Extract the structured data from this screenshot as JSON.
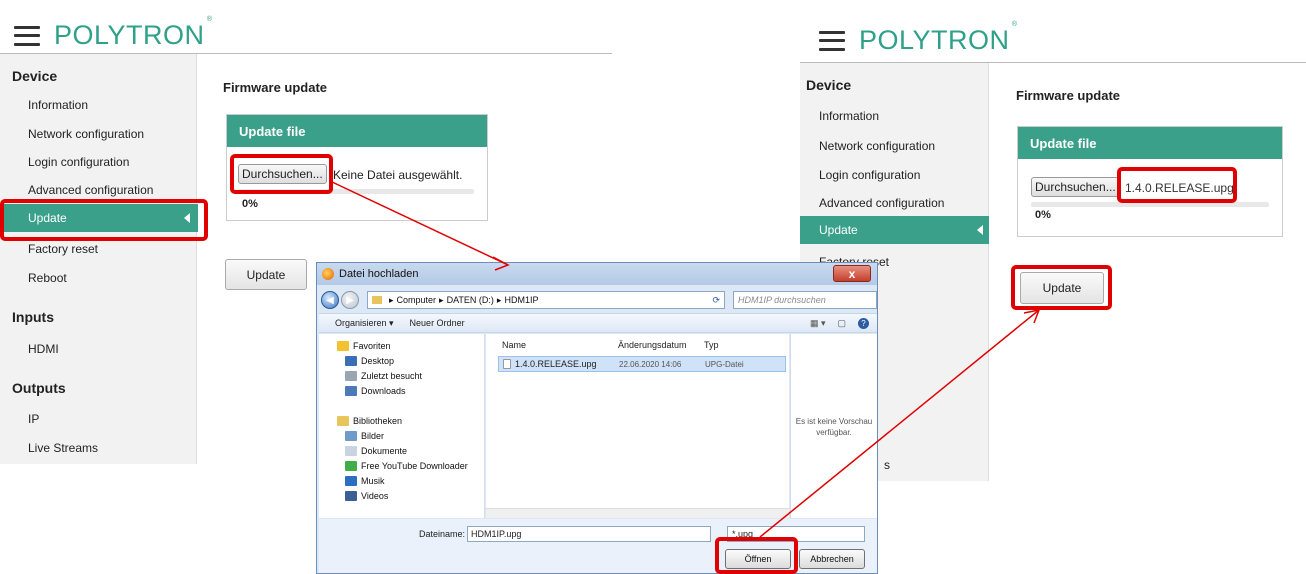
{
  "logo": "POLYTRON",
  "logo_mark": "®",
  "left_panel": {
    "sections": [
      {
        "title": "Device",
        "items": [
          "Information",
          "Network configuration",
          "Login configuration",
          "Advanced configuration",
          "Update",
          "Factory reset",
          "Reboot"
        ]
      },
      {
        "title": "Inputs",
        "items": [
          "HDMI"
        ]
      },
      {
        "title": "Outputs",
        "items": [
          "IP",
          "Live Streams"
        ]
      }
    ],
    "active_item": "Update",
    "page_title": "Firmware update",
    "card_title": "Update file",
    "browse_label": "Durchsuchen...",
    "file_status": "Keine Datei ausgewählt.",
    "progress_text": "0%",
    "update_button": "Update"
  },
  "right_panel": {
    "sections": [
      {
        "title": "Device",
        "items": [
          "Information",
          "Network configuration",
          "Login configuration",
          "Advanced configuration",
          "Update",
          "Factory reset"
        ]
      }
    ],
    "active_item": "Update",
    "page_title": "Firmware update",
    "card_title": "Update file",
    "browse_label": "Durchsuchen...",
    "file_status": "1.4.0.RELEASE.upg",
    "progress_text": "0%",
    "update_button": "Update",
    "hidden_tail": "s"
  },
  "dialog": {
    "title": "Datei hochladen",
    "close": "x",
    "breadcrumb": [
      "Computer",
      "DATEN (D:)",
      "HDM1IP"
    ],
    "search_placeholder": "HDM1IP durchsuchen",
    "toolbar": {
      "organize": "Organisieren ▾",
      "new_folder": "Neuer Ordner"
    },
    "tree": {
      "favorites_label": "Favoriten",
      "favorites": [
        "Desktop",
        "Zuletzt besucht",
        "Downloads"
      ],
      "libraries_label": "Bibliotheken",
      "libraries": [
        "Bilder",
        "Dokumente",
        "Free YouTube Downloader",
        "Musik",
        "Videos"
      ]
    },
    "columns": [
      "Name",
      "Änderungsdatum",
      "Typ"
    ],
    "files": [
      {
        "name": "1.4.0.RELEASE.upg",
        "date": "22.06.2020 14:06",
        "type": "UPG-Datei"
      }
    ],
    "preview_text": "Es ist keine Vorschau verfügbar.",
    "filename_label": "Dateiname:",
    "filename_value": "HDM1IP.upg",
    "filter": "*.upg",
    "open_button": "Öffnen",
    "cancel_button": "Abbrechen"
  },
  "colors": {
    "accent": "#3aa08a",
    "highlight": "#e10000"
  }
}
